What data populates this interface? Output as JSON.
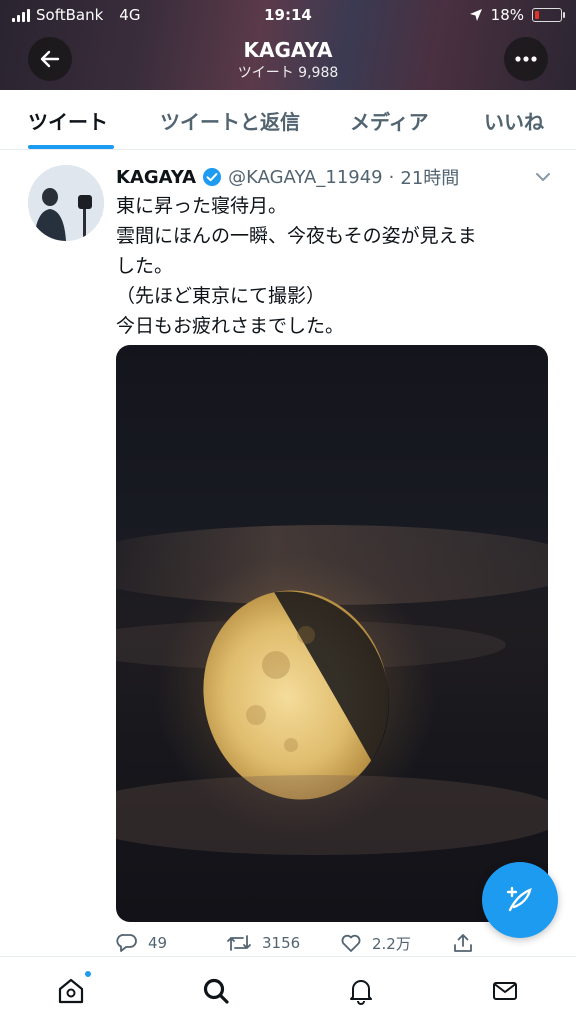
{
  "status": {
    "carrier": "SoftBank",
    "network": "4G",
    "time": "19:14",
    "battery": "18%",
    "battery_level": 0.18
  },
  "header": {
    "title": "KAGAYA",
    "subtitle": "ツイート 9,988"
  },
  "tabs": [
    {
      "label": "ツイート"
    },
    {
      "label": "ツイートと返信"
    },
    {
      "label": "メディア"
    },
    {
      "label": "いいね"
    }
  ],
  "tweet": {
    "name": "KAGAYA",
    "handle": "@KAGAYA_11949",
    "dot": "·",
    "time": "21時間",
    "lines": [
      "東に昇った寝待月。",
      "雲間にほんの一瞬、今夜もその姿が見えま",
      "した。",
      "（先ほど東京にて撮影）",
      "今日もお疲れさまでした。"
    ],
    "replies": "49",
    "retweets": "3156",
    "likes": "2.2万"
  },
  "colors": {
    "accent": "#1d9bf0",
    "text": "#0f1419",
    "muted": "#536471"
  },
  "icons": {
    "back": "arrow-left-icon",
    "more": "more-icon",
    "verified": "verified-badge-icon",
    "caret": "chevron-down-icon",
    "reply": "reply-icon",
    "retweet": "retweet-icon",
    "like": "heart-icon",
    "share": "share-icon",
    "compose": "compose-icon",
    "home": "home-icon",
    "search": "search-icon",
    "notifications": "bell-icon",
    "messages": "mail-icon"
  }
}
